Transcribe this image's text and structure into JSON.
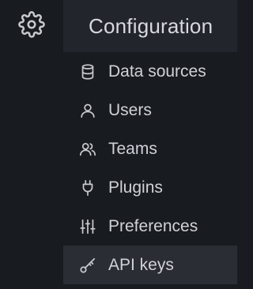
{
  "rail": {
    "icon": "gear-icon"
  },
  "dropdown": {
    "title": "Configuration",
    "items": [
      {
        "label": "Data sources",
        "icon": "database-icon",
        "active": false
      },
      {
        "label": "Users",
        "icon": "user-icon",
        "active": false
      },
      {
        "label": "Teams",
        "icon": "users-icon",
        "active": false
      },
      {
        "label": "Plugins",
        "icon": "plug-icon",
        "active": false
      },
      {
        "label": "Preferences",
        "icon": "sliders-icon",
        "active": false
      },
      {
        "label": "API keys",
        "icon": "key-icon",
        "active": true
      }
    ]
  },
  "colors": {
    "background": "#181b1f",
    "header": "#22252b",
    "active_item": "#2a2d33",
    "text": "#d0d1d9",
    "icon": "#c7c8d0"
  }
}
